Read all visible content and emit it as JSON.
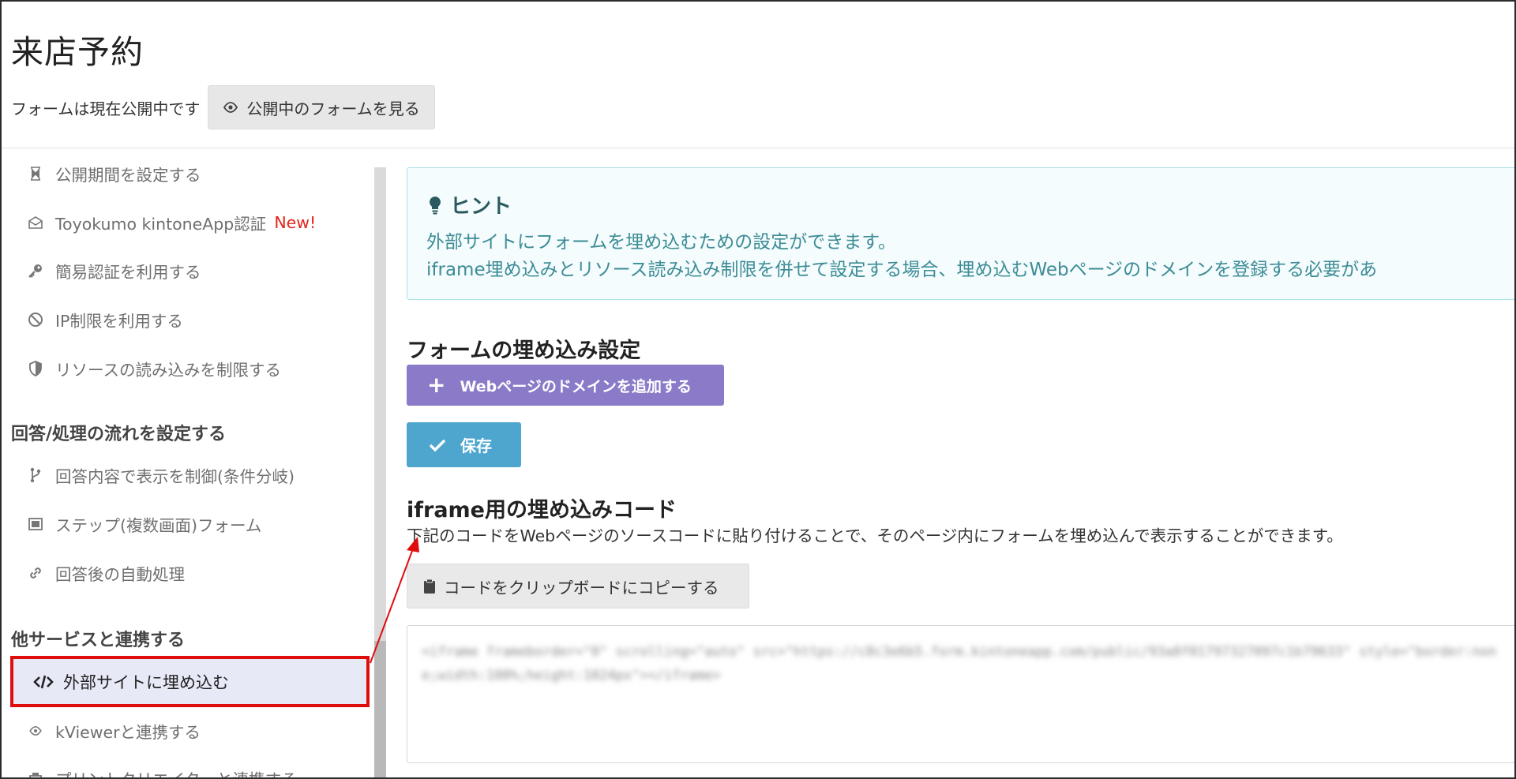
{
  "page": {
    "title": "来店予約",
    "status_text": "フォームは現在公開中です",
    "view_form_label": "公開中のフォームを見る"
  },
  "sidebar": {
    "items_top": [
      {
        "label": "公開期間を設定する",
        "icon": "hourglass-icon"
      },
      {
        "label": "Toyokumo kintoneApp認証",
        "icon": "envelope-open-icon",
        "badge": "New!"
      },
      {
        "label": "簡易認証を利用する",
        "icon": "key-icon"
      },
      {
        "label": "IP制限を利用する",
        "icon": "ban-icon"
      },
      {
        "label": "リソースの読み込みを制限する",
        "icon": "shield-icon"
      }
    ],
    "section_flow": "回答/処理の流れを設定する",
    "items_flow": [
      {
        "label": "回答内容で表示を制御(条件分岐)",
        "icon": "branch-icon"
      },
      {
        "label": "ステップ(複数画面)フォーム",
        "icon": "window-icon"
      },
      {
        "label": "回答後の自動処理",
        "icon": "link-icon"
      }
    ],
    "section_integrations": "他サービスと連携する",
    "active_item": {
      "label": "外部サイトに埋め込む",
      "icon": "code-icon"
    },
    "items_integrations": [
      {
        "label": "kViewerと連携する",
        "icon": "eye-icon"
      },
      {
        "label": "プリントクリエイターと連携する",
        "icon": "printer-icon"
      }
    ]
  },
  "hint": {
    "title": "ヒント",
    "line1": "外部サイトにフォームを埋め込むための設定ができます。",
    "line2": "iframe埋め込みとリソース読み込み制限を併せて設定する場合、埋め込むWebページのドメインを登録する必要があ"
  },
  "embed_settings": {
    "heading": "フォームの埋め込み設定",
    "add_domain_label": "Webページのドメインを追加する",
    "save_label": "保存"
  },
  "iframe_code": {
    "heading": "iframe用の埋め込みコード",
    "description": "下記のコードをWebページのソースコードに貼り付けることで、そのページ内にフォームを埋め込んで表示することができます。",
    "copy_label": "コードをクリップボードにコピーする",
    "code": "<iframe frameborder=\"0\" scrolling=\"auto\" src=\"https://c8c3e6b5.form.kintoneapp.com/public/93a8f01797327097c1b79633\" style=\"border:none;width:100%;height:1024px\"></iframe>"
  },
  "colors": {
    "accent_purple": "#8a7ac8",
    "accent_blue": "#4ea6cf",
    "highlight_red": "#e00d0d",
    "hint_text": "#3d8c96"
  }
}
